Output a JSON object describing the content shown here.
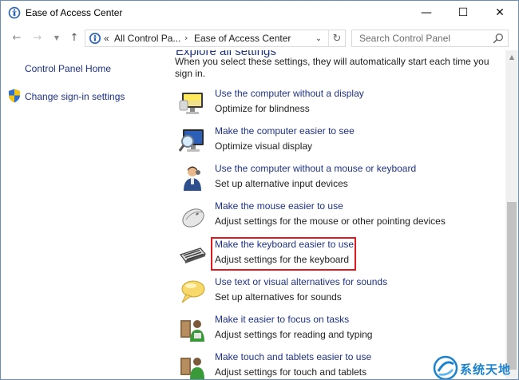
{
  "window": {
    "title": "Ease of Access Center",
    "controls": {
      "minimize": "—",
      "maximize": "☐",
      "close": "✕"
    }
  },
  "navbar": {
    "address": {
      "chevron": "«",
      "crumb1": "All Control Pa...",
      "separator": "›",
      "crumb2": "Ease of Access Center"
    },
    "search": {
      "placeholder": "Search Control Panel"
    }
  },
  "leftpane": {
    "home": "Control Panel Home",
    "signin": "Change sign-in settings"
  },
  "main": {
    "section_heading": "Explore all settings",
    "intro": "When you select these settings, they will automatically start each time you sign in.",
    "items": [
      {
        "icon": "monitor-icon",
        "link": "Use the computer without a display",
        "desc": "Optimize for blindness"
      },
      {
        "icon": "magnifier-monitor-icon",
        "link": "Make the computer easier to see",
        "desc": "Optimize visual display"
      },
      {
        "icon": "person-icon",
        "link": "Use the computer without a mouse or keyboard",
        "desc": "Set up alternative input devices"
      },
      {
        "icon": "mouse-icon",
        "link": "Make the mouse easier to use",
        "desc": "Adjust settings for the mouse or other pointing devices"
      },
      {
        "icon": "keyboard-icon",
        "link": "Make the keyboard easier to use",
        "desc": "Adjust settings for the keyboard"
      },
      {
        "icon": "speech-bubble-icon",
        "link": "Use text or visual alternatives for sounds",
        "desc": "Set up alternatives for sounds"
      },
      {
        "icon": "people-icon",
        "link": "Make it easier to focus on tasks",
        "desc": "Adjust settings for reading and typing"
      },
      {
        "icon": "touch-people-icon",
        "link": "Make touch and tablets easier to use",
        "desc": "Adjust settings for touch and tablets"
      }
    ]
  },
  "watermark": {
    "text": "系统天地"
  },
  "colors": {
    "link": "#1e3287",
    "highlight": "#e0191f",
    "watermark": "#1a82cf"
  }
}
